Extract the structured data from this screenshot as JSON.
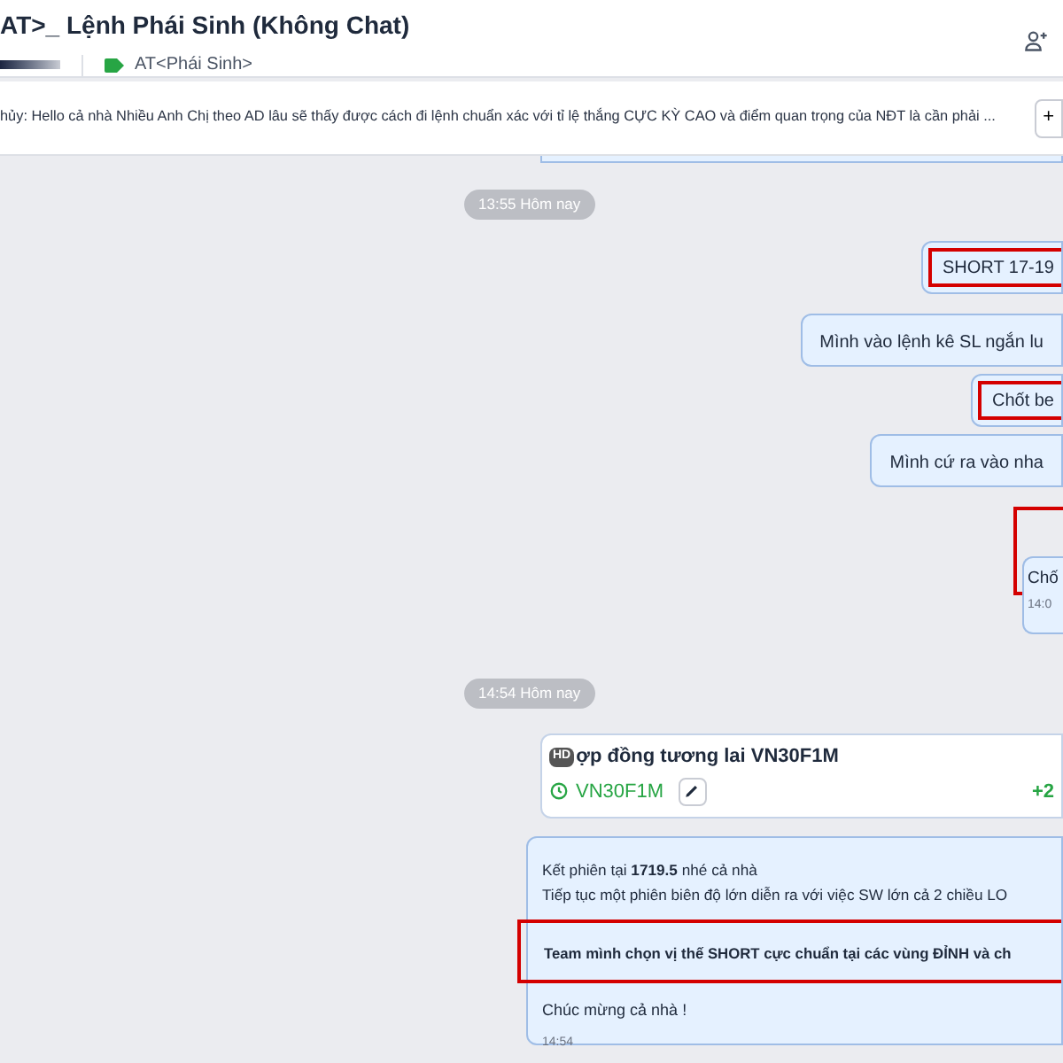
{
  "header": {
    "title": "AT>_ Lệnh Phái Sinh (Không Chat)",
    "tag": "AT<Phái Sinh>"
  },
  "pinned": {
    "text": "hủy: Hello cả nhà Nhiều Anh Chị theo AD lâu sẽ thấy được cách đi lệnh chuẩn xác với tỉ lệ thắng CỰC KỲ CAO và điểm quan trọng của NĐT là cần phải ...",
    "button": "+"
  },
  "messages": [
    {
      "kind": "divider",
      "text": "13:55 Hôm nay"
    },
    {
      "kind": "bubble",
      "text": "SHORT 17-19",
      "highlighted": true
    },
    {
      "kind": "bubble",
      "text": "Mình vào lệnh kê SL ngắn lu",
      "highlighted": false
    },
    {
      "kind": "bubble",
      "text": "Chốt be",
      "highlighted": true
    },
    {
      "kind": "bubble",
      "text": "Mình cứ ra vào nha",
      "highlighted": false
    },
    {
      "kind": "timed",
      "text": "Chố",
      "time": "14:0",
      "highlighted": true
    },
    {
      "kind": "divider",
      "text": "14:54 Hôm nay"
    },
    {
      "kind": "card",
      "badge": "HD",
      "title": "ợp đồng tương lai VN30F1M",
      "symbol": "VN30F1M",
      "change": "+2"
    },
    {
      "kind": "post",
      "lines": [
        "Kết phiên tại **1719.5** nhé cả nhà",
        "Tiếp tục một phiên biên độ lớn diễn ra với việc SW lớn cả 2 chiều LO"
      ],
      "highlight": "Team mình chọn vị thế SHORT cực chuẩn tại các vùng ĐỈNH và ch",
      "closing": "Chúc mừng cả nhà !",
      "time": "14:54"
    }
  ]
}
